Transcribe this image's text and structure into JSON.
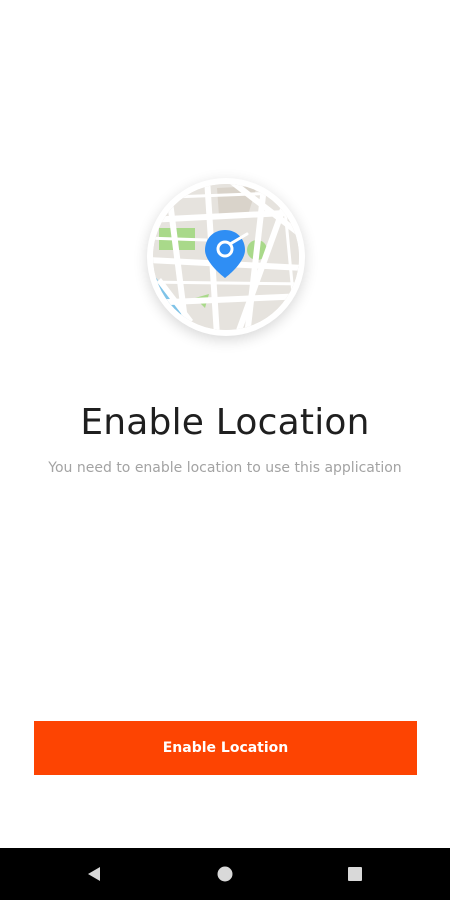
{
  "illustration": {
    "icon": "map-location-pin-icon",
    "colors": {
      "pin": "#2f8ef4",
      "park": "#a9d98a",
      "water": "#7ec3e8",
      "land": "#e6e3de",
      "road": "#ffffff"
    }
  },
  "content": {
    "title": "Enable Location",
    "subtitle": "You need to enable location to use this application"
  },
  "button": {
    "label": "Enable Location",
    "color": "#fd4402"
  },
  "navbar": {
    "back_icon": "back-triangle-icon",
    "home_icon": "home-circle-icon",
    "recent_icon": "recent-apps-square-icon"
  }
}
